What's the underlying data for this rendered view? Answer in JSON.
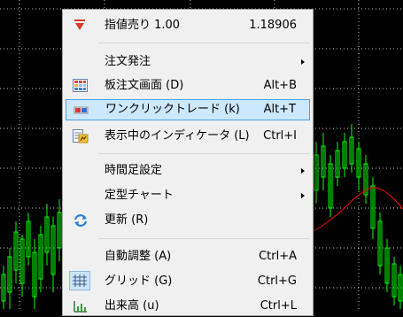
{
  "chart": {
    "background": "#000000",
    "candle_color": "#00ff00",
    "ma_color": "#ff0000",
    "grid_color": "#ffffff"
  },
  "menu": {
    "items": [
      {
        "label": "指値売り 1.00",
        "shortcut": "1.18906",
        "icon": "sell-arrow-icon",
        "submenu": false
      },
      {
        "label": "注文発注",
        "shortcut": "",
        "icon": "",
        "submenu": true
      },
      {
        "label": "板注文画面 (D)",
        "shortcut": "Alt+B",
        "icon": "depth-of-market-icon",
        "submenu": false
      },
      {
        "label": "ワンクリックトレード (k)",
        "shortcut": "Alt+T",
        "icon": "one-click-trading-icon",
        "submenu": false,
        "highlighted": true
      },
      {
        "label": "表示中のインディケータ (L)",
        "shortcut": "Ctrl+I",
        "icon": "indicators-list-icon",
        "submenu": false
      },
      {
        "label": "時間足設定",
        "shortcut": "",
        "icon": "",
        "submenu": true
      },
      {
        "label": "定型チャート",
        "shortcut": "",
        "icon": "",
        "submenu": true
      },
      {
        "label": "更新 (R)",
        "shortcut": "",
        "icon": "refresh-icon",
        "submenu": false
      },
      {
        "label": "自動調整 (A)",
        "shortcut": "Ctrl+A",
        "icon": "",
        "submenu": false
      },
      {
        "label": "グリッド (G)",
        "shortcut": "Ctrl+G",
        "icon": "grid-icon",
        "submenu": false,
        "checked": true
      },
      {
        "label": "出来高 (u)",
        "shortcut": "Ctrl+L",
        "icon": "volume-icon",
        "submenu": false
      }
    ]
  }
}
